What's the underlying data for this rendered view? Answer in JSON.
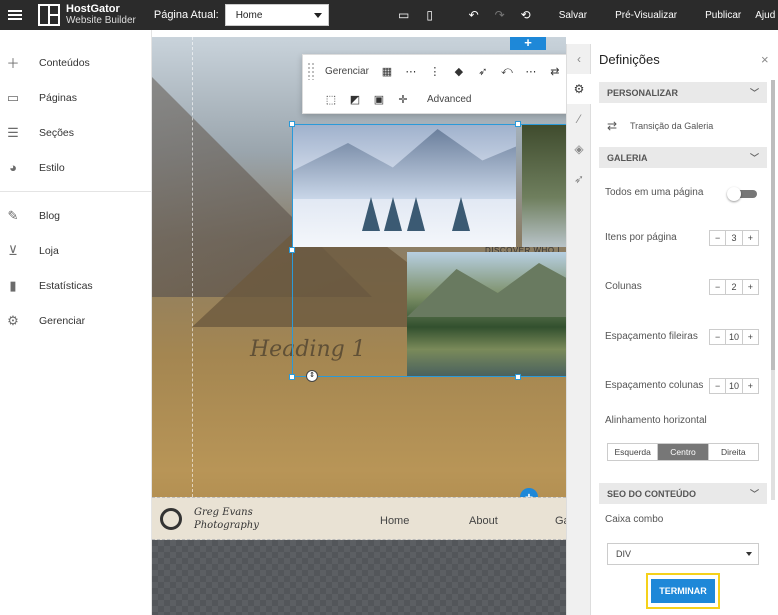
{
  "topbar": {
    "brand_name": "HostGator",
    "brand_sub": "Website Builder",
    "page_label": "Página Atual:",
    "page_value": "Home",
    "save": "Salvar",
    "preview": "Pré-Visualizar",
    "publish": "Publicar",
    "help": "Ajud"
  },
  "sidebar": {
    "items": [
      {
        "label": "Conteúdos",
        "icon": "plus-icon"
      },
      {
        "label": "Páginas",
        "icon": "pages-icon"
      },
      {
        "label": "Seções",
        "icon": "sections-icon"
      },
      {
        "label": "Estilo",
        "icon": "palette-icon"
      },
      {
        "label": "Blog",
        "icon": "pencil-icon"
      },
      {
        "label": "Loja",
        "icon": "cart-icon"
      },
      {
        "label": "Estatísticas",
        "icon": "bar-chart-icon"
      },
      {
        "label": "Gerenciar",
        "icon": "gear-icon"
      }
    ]
  },
  "toolbar": {
    "manage": "Gerenciar",
    "advanced": "Advanced"
  },
  "canvas": {
    "discover": "DISCOVER WHO I AM",
    "heading": "Heading 1",
    "site_logo_line1": "Greg Evans",
    "site_logo_line2": "Photography",
    "nav": [
      "Home",
      "About",
      "Ga"
    ]
  },
  "panel": {
    "title": "Definições",
    "sec_custom": "PERSONALIZAR",
    "gallery_transition": "Transição da Galeria",
    "sec_gallery": "GALERIA",
    "all_one_page": "Todos em uma página",
    "items_per_page_label": "Itens por página",
    "items_per_page": "3",
    "columns_label": "Colunas",
    "columns": "2",
    "row_spacing_label": "Espaçamento fileiras",
    "row_spacing": "10",
    "col_spacing_label": "Espaçamento colunas",
    "col_spacing": "10",
    "halign_label": "Alinhamento horizontal",
    "align_left": "Esquerda",
    "align_center": "Centro",
    "align_right": "Direita",
    "sec_seo": "SEO DO CONTEÚDO",
    "combo_label": "Caixa combo",
    "combo_value": "DIV",
    "finish": "TERMINAR",
    "minus": "−",
    "plus": "+"
  },
  "colors": {
    "accent": "#1e88d8",
    "highlight": "#f5d11a",
    "topbar": "#2b2b2b"
  }
}
